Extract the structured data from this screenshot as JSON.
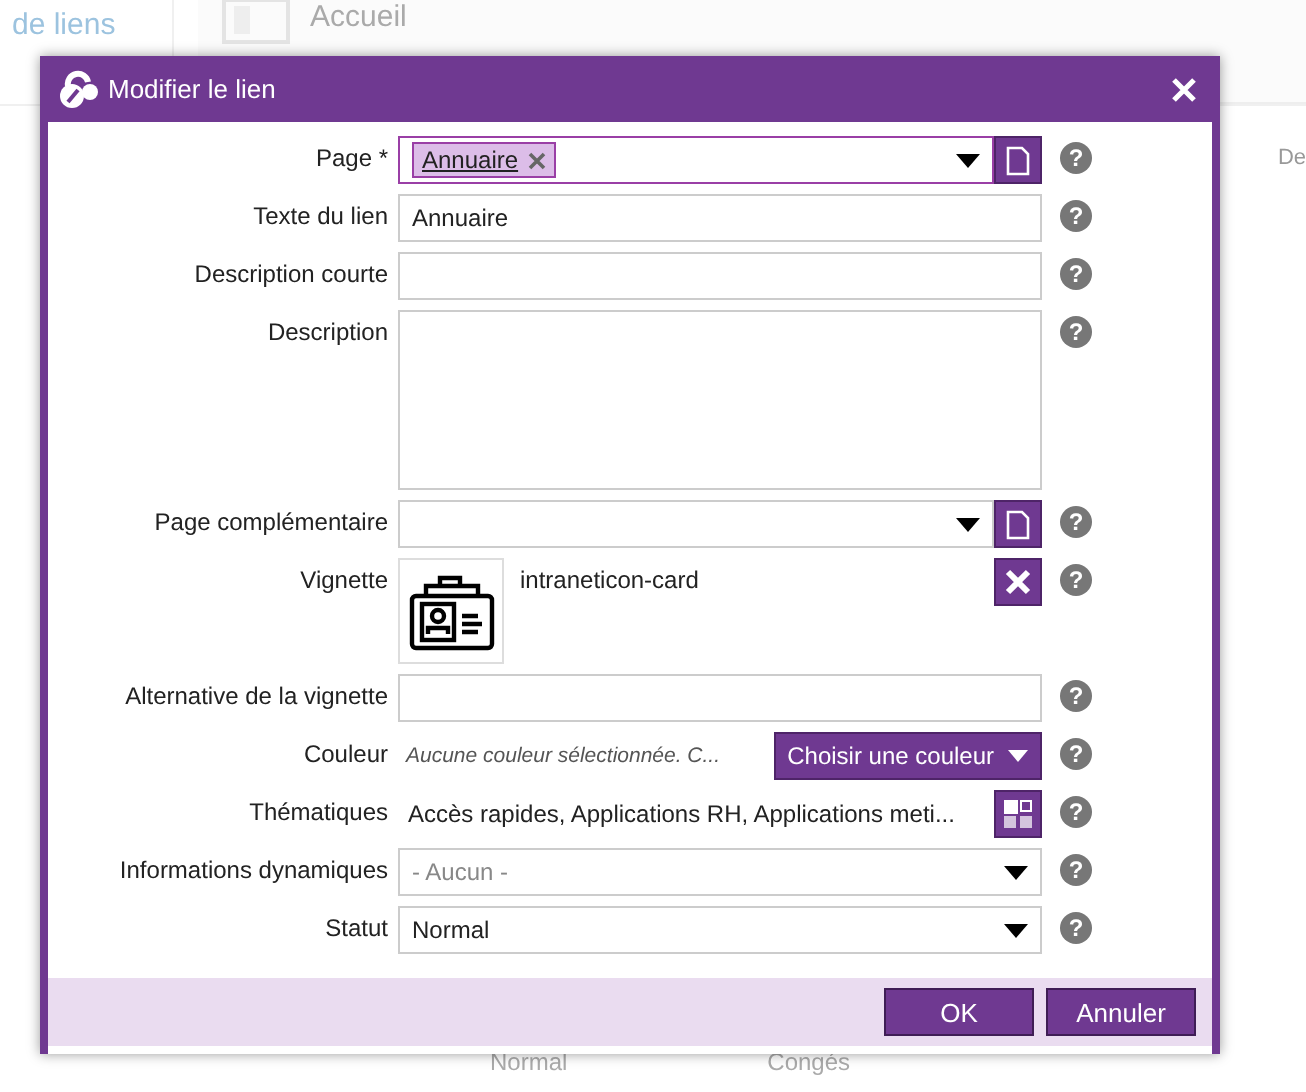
{
  "background": {
    "tab": "de liens",
    "page_title": "Accueil",
    "column_header": "De",
    "cells": [
      "Normal",
      "Congés"
    ]
  },
  "dialog": {
    "title": "Modifier le lien",
    "fields": [
      {
        "kind": "tags",
        "label": "Page *",
        "tags": [
          "Annuaire"
        ],
        "help": "?"
      },
      {
        "kind": "text",
        "label": "Texte du lien",
        "value": "Annuaire",
        "help": "?"
      },
      {
        "kind": "text",
        "label": "Description courte",
        "help": "?"
      },
      {
        "kind": "textarea",
        "label": "Description",
        "help": "?"
      },
      {
        "kind": "page-select",
        "label": "Page complémentaire",
        "help": "?"
      },
      {
        "kind": "image",
        "label": "Vignette",
        "value": "intraneticon-card",
        "help": "?"
      },
      {
        "kind": "text",
        "label": "Alternative de la vignette",
        "help": "?"
      },
      {
        "kind": "color",
        "label": "Couleur",
        "note": "Aucune couleur sélectionnée. C...",
        "button": "Choisir une couleur",
        "help": "?"
      },
      {
        "kind": "list",
        "label": "Thématiques",
        "value": "Accès rapides, Applications RH, Applications meti...",
        "help": "?"
      },
      {
        "kind": "select",
        "label": "Informations dynamiques",
        "placeholder": "- Aucun -",
        "help": "?"
      },
      {
        "kind": "select",
        "label": "Statut",
        "value": "Normal",
        "help": "?"
      }
    ],
    "buttons": [
      {
        "label": "OK"
      },
      {
        "label": "Annuler"
      }
    ]
  }
}
